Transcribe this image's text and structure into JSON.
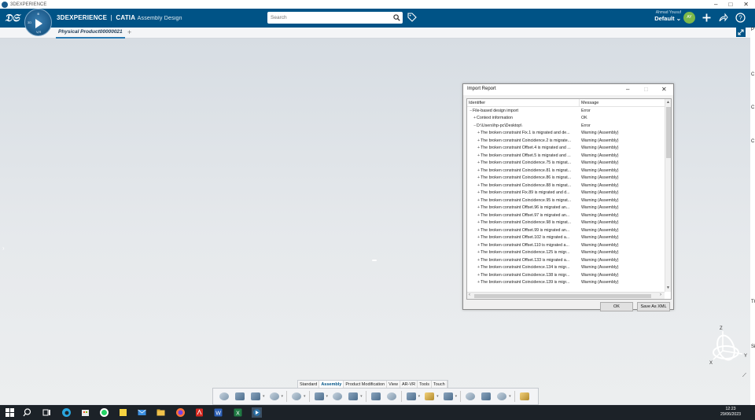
{
  "os_window": {
    "title": "3DEXPERIENCE",
    "controls": [
      "–",
      "□",
      "✕"
    ]
  },
  "header": {
    "brand_bold": "3DEXPERIENCE",
    "brand_sep": "|",
    "brand_app": "CATIA",
    "brand_workbench": "Assembly Design",
    "compass_labels": {
      "top": "⊗",
      "left": "3D",
      "bottom": "V,R"
    },
    "search_placeholder": "Search",
    "user_name": "Ahmad Yousuf",
    "collab_space": "Default ⌄",
    "avatar_initials": "AY",
    "colors": {
      "bar": "#005386",
      "accent": "#2a7ab3",
      "avatar": "#7db84a"
    }
  },
  "tabs": {
    "active_label": "Physical Product00000021",
    "add_label": "+"
  },
  "viewport": {
    "side_arrow": "›",
    "right_edge_letters": [
      "P",
      "C",
      "C",
      "C",
      "TC",
      "Si"
    ]
  },
  "dialog": {
    "title": "Import Report",
    "columns": {
      "identifier": "Identifier",
      "message": "Message"
    },
    "rows": [
      {
        "toggle": "−",
        "indent": 0,
        "id": "File-based design import",
        "msg": "Error"
      },
      {
        "toggle": "+",
        "indent": 1,
        "id": "Context information",
        "msg": "OK"
      },
      {
        "toggle": "−",
        "indent": 1,
        "id": "D:\\Users\\hp-pc\\Desktop\\",
        "msg": "Error"
      },
      {
        "toggle": "+",
        "indent": 2,
        "id": "The broken constraint Fix.1 is migrated and de...",
        "msg": "Warning (Assembly)"
      },
      {
        "toggle": "+",
        "indent": 2,
        "id": "The broken constraint Coincidence.2 is migrate...",
        "msg": "Warning (Assembly)"
      },
      {
        "toggle": "+",
        "indent": 2,
        "id": "The broken constraint Offset.4 is migrated and ...",
        "msg": "Warning (Assembly)"
      },
      {
        "toggle": "+",
        "indent": 2,
        "id": "The broken constraint Offset.5 is migrated and ...",
        "msg": "Warning (Assembly)"
      },
      {
        "toggle": "+",
        "indent": 2,
        "id": "The broken constraint Coincidence.75 is migrat...",
        "msg": "Warning (Assembly)"
      },
      {
        "toggle": "+",
        "indent": 2,
        "id": "The broken constraint Coincidence.81 is migrat...",
        "msg": "Warning (Assembly)"
      },
      {
        "toggle": "+",
        "indent": 2,
        "id": "The broken constraint Coincidence.86 is migrat...",
        "msg": "Warning (Assembly)"
      },
      {
        "toggle": "+",
        "indent": 2,
        "id": "The broken constraint Coincidence.88 is migrat...",
        "msg": "Warning (Assembly)"
      },
      {
        "toggle": "+",
        "indent": 2,
        "id": "The broken constraint Fix.89 is migrated and d...",
        "msg": "Warning (Assembly)"
      },
      {
        "toggle": "+",
        "indent": 2,
        "id": "The broken constraint Coincidence.95 is migrat...",
        "msg": "Warning (Assembly)"
      },
      {
        "toggle": "+",
        "indent": 2,
        "id": "The broken constraint Offset.96 is migrated an...",
        "msg": "Warning (Assembly)"
      },
      {
        "toggle": "+",
        "indent": 2,
        "id": "The broken constraint Offset.97 is migrated an...",
        "msg": "Warning (Assembly)"
      },
      {
        "toggle": "+",
        "indent": 2,
        "id": "The broken constraint Coincidence.98 is migrat...",
        "msg": "Warning (Assembly)"
      },
      {
        "toggle": "+",
        "indent": 2,
        "id": "The broken constraint Offset.99 is migrated an...",
        "msg": "Warning (Assembly)"
      },
      {
        "toggle": "+",
        "indent": 2,
        "id": "The broken constraint Offset.102 is migrated a...",
        "msg": "Warning (Assembly)"
      },
      {
        "toggle": "+",
        "indent": 2,
        "id": "The broken constraint Offset.110 is migrated a...",
        "msg": "Warning (Assembly)"
      },
      {
        "toggle": "+",
        "indent": 2,
        "id": "The broken constraint Coincidence.125 is migr...",
        "msg": "Warning (Assembly)"
      },
      {
        "toggle": "+",
        "indent": 2,
        "id": "The broken constraint Offset.133 is migrated a...",
        "msg": "Warning (Assembly)"
      },
      {
        "toggle": "+",
        "indent": 2,
        "id": "The broken constraint Coincidence.134 is migr...",
        "msg": "Warning (Assembly)"
      },
      {
        "toggle": "+",
        "indent": 2,
        "id": "The broken constraint Coincidence.138 is migr...",
        "msg": "Warning (Assembly)"
      },
      {
        "toggle": "+",
        "indent": 2,
        "id": "The broken constraint Coincidence.139 is migr...",
        "msg": "Warning (Assembly)"
      }
    ],
    "ok_label": "OK",
    "save_xml_label": "Save As XML"
  },
  "action_bar": {
    "section_tabs": [
      "Standard",
      "Assembly",
      "Product Modification",
      "View",
      "AR-VR",
      "Tools",
      "Touch"
    ],
    "active_section": "Assembly"
  },
  "triad_axes": {
    "x": "X",
    "y": "Y",
    "z": "Z"
  },
  "taskbar": {
    "time": "12:23",
    "date": "29/06/2023"
  }
}
